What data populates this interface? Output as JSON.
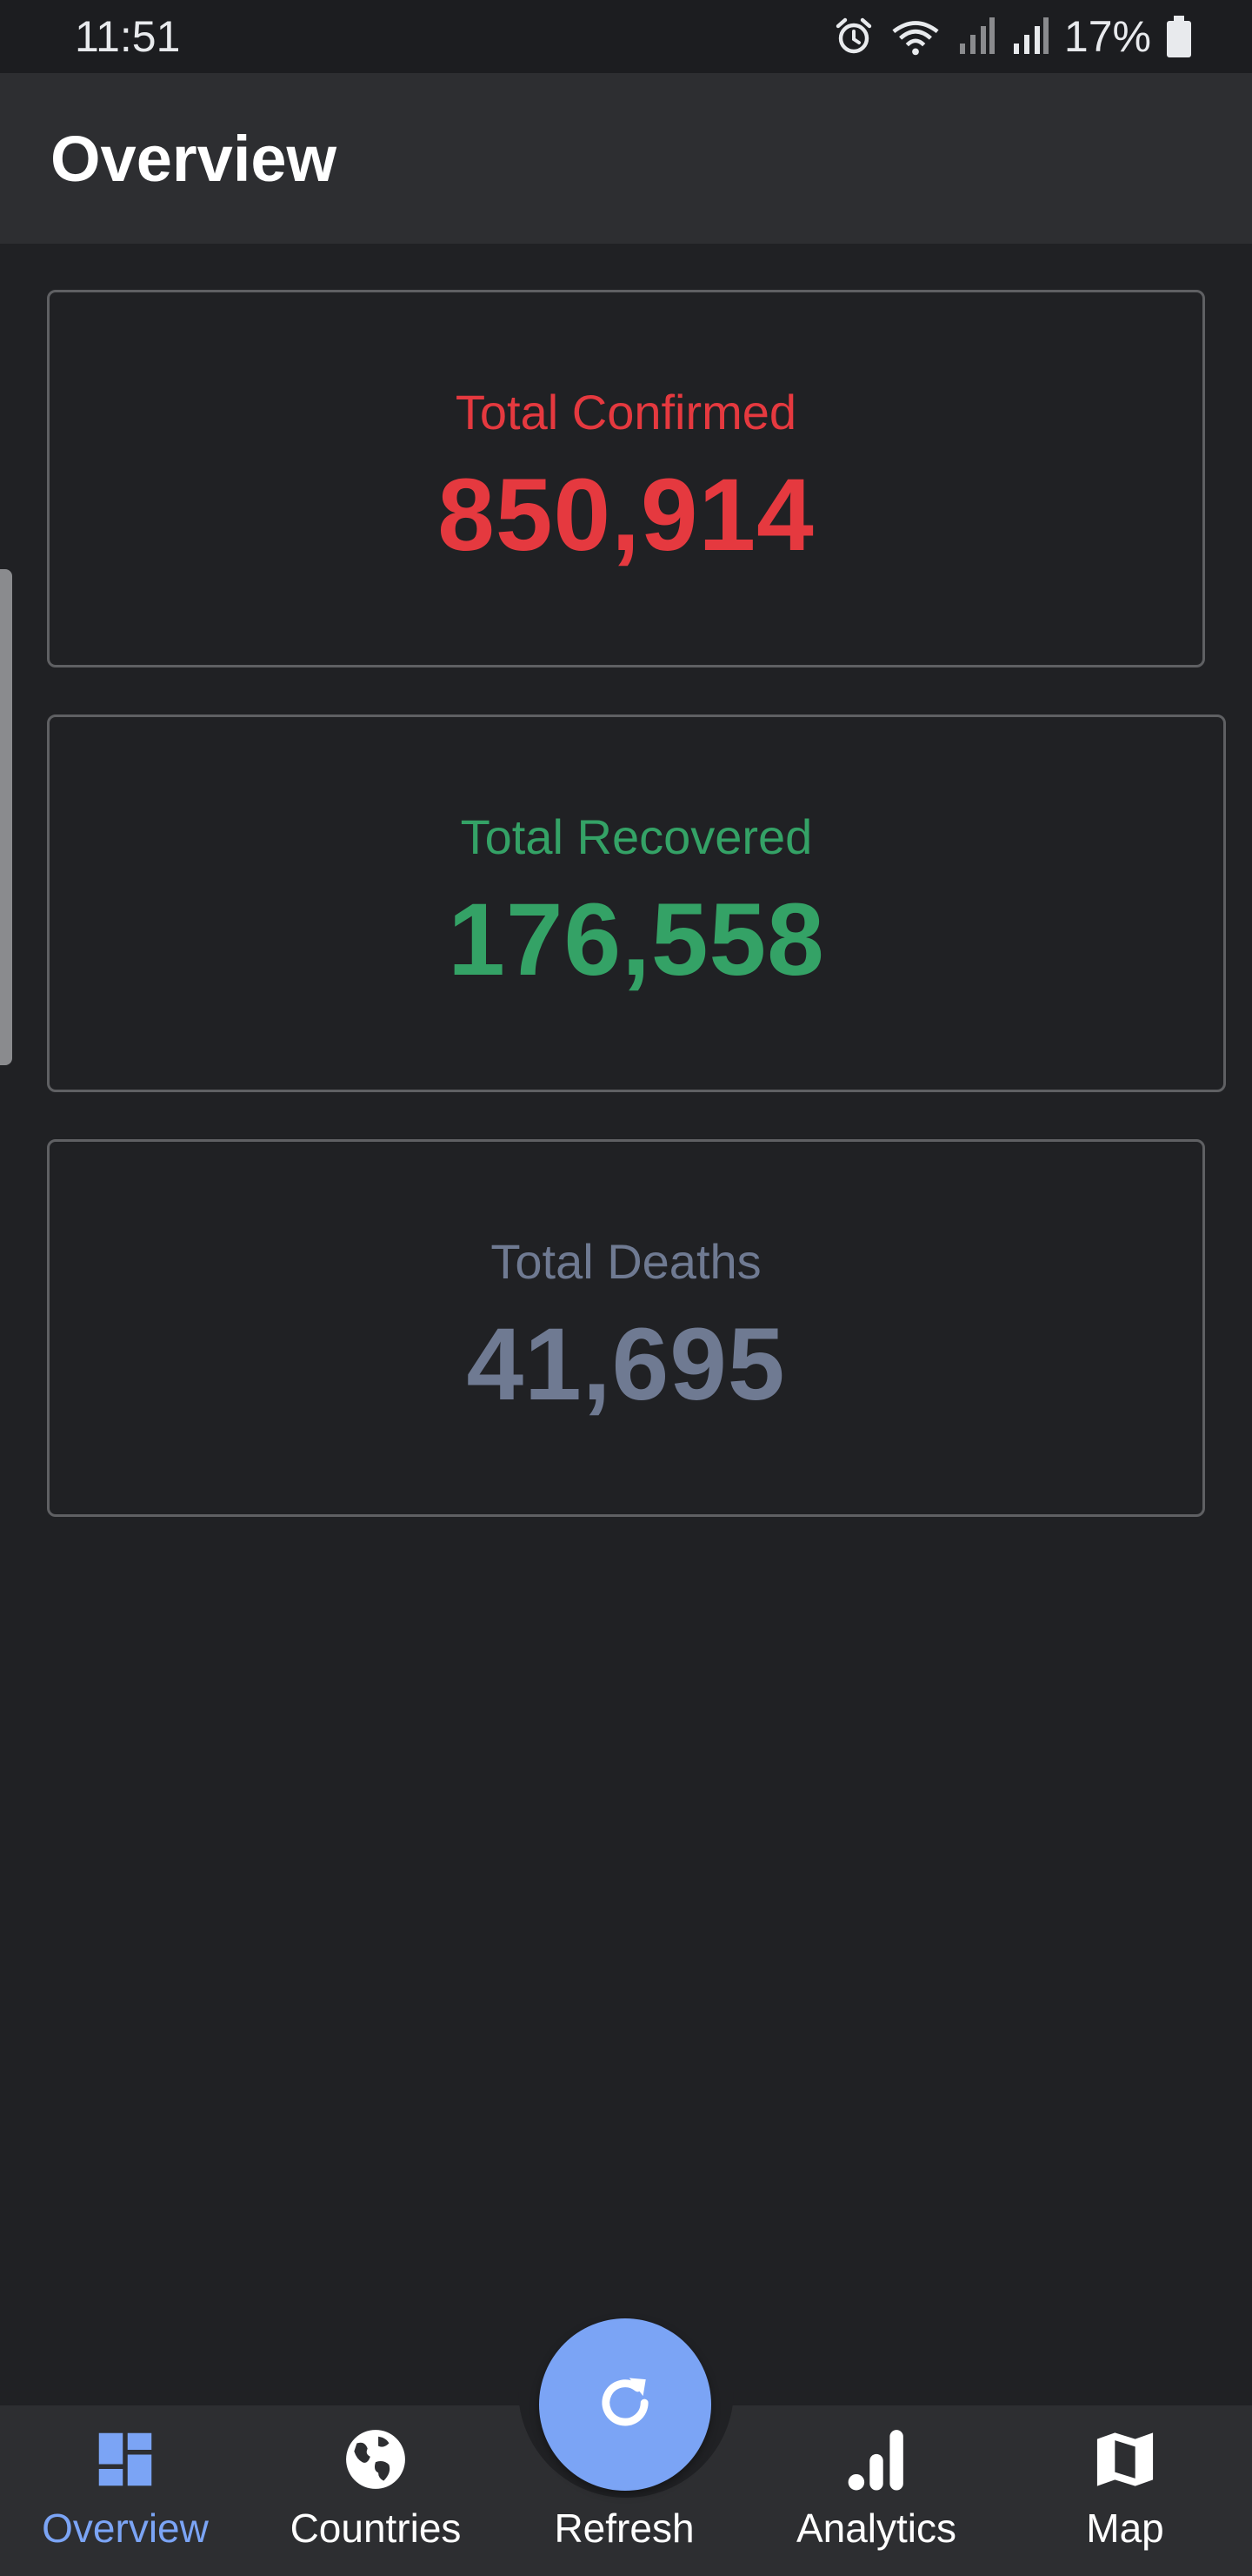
{
  "status_bar": {
    "time": "11:51",
    "battery": "17%",
    "icons": [
      "alarm-icon",
      "wifi-icon",
      "signal-icon",
      "signal-icon",
      "battery-icon"
    ]
  },
  "app_bar": {
    "title": "Overview"
  },
  "cards": {
    "confirmed": {
      "label": "Total Confirmed",
      "value": "850,914",
      "color": "#e5393f"
    },
    "recovered": {
      "label": "Total Recovered",
      "value": "176,558",
      "color": "#34a266"
    },
    "deaths": {
      "label": "Total Deaths",
      "value": "41,695",
      "color": "#6f7a92"
    }
  },
  "bottom_nav": {
    "items": [
      {
        "label": "Overview",
        "icon": "dashboard-icon",
        "active": true
      },
      {
        "label": "Countries",
        "icon": "globe-icon",
        "active": false
      },
      {
        "label": "Refresh",
        "icon": "refresh-icon",
        "active": false
      },
      {
        "label": "Analytics",
        "icon": "bar-chart-icon",
        "active": false
      },
      {
        "label": "Map",
        "icon": "map-icon",
        "active": false
      }
    ]
  },
  "colors": {
    "background": "#202124",
    "app_bar": "#2d2e31",
    "accent": "#7ba4f5"
  }
}
